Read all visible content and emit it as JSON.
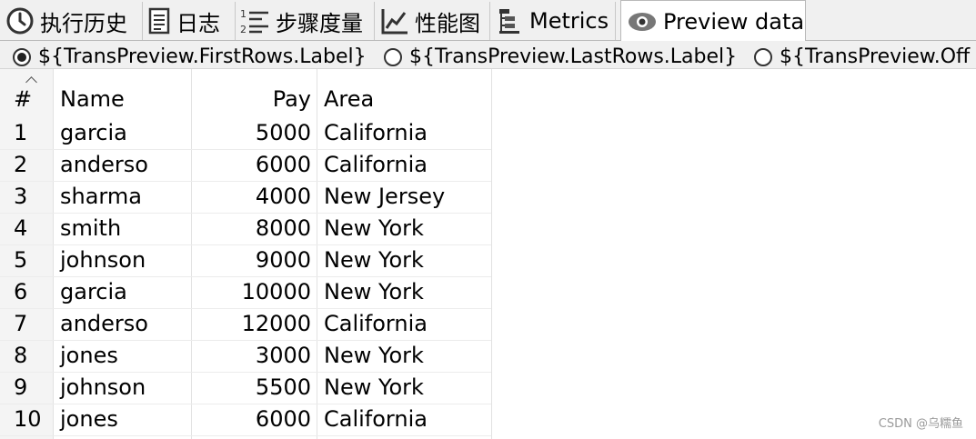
{
  "tabs": [
    {
      "label": "执行历史",
      "icon": "clock-icon"
    },
    {
      "label": "日志",
      "icon": "document-icon"
    },
    {
      "label": "步骤度量",
      "icon": "numbered-list-icon"
    },
    {
      "label": "性能图",
      "icon": "line-chart-icon"
    },
    {
      "label": "Metrics",
      "icon": "hierarchy-icon"
    },
    {
      "label": "Preview data",
      "icon": "eye-icon",
      "active": true
    }
  ],
  "radios": [
    {
      "label": "${TransPreview.FirstRows.Label}",
      "checked": true
    },
    {
      "label": "${TransPreview.LastRows.Label}",
      "checked": false
    },
    {
      "label": "${TransPreview.Off",
      "checked": false
    }
  ],
  "table": {
    "headers": [
      "#",
      "Name",
      "Pay",
      "Area"
    ],
    "rows": [
      [
        "1",
        "garcia",
        "5000",
        "California"
      ],
      [
        "2",
        "anderso",
        "6000",
        "California"
      ],
      [
        "3",
        "sharma",
        "4000",
        "New Jersey"
      ],
      [
        "4",
        "smith",
        "8000",
        "New York"
      ],
      [
        "5",
        "johnson",
        "9000",
        "New York"
      ],
      [
        "6",
        "garcia",
        "10000",
        "New York"
      ],
      [
        "7",
        "anderso",
        "12000",
        "California"
      ],
      [
        "8",
        "jones",
        "3000",
        "New York"
      ],
      [
        "9",
        "johnson",
        "5500",
        "New York"
      ],
      [
        "10",
        "jones",
        "6000",
        "California"
      ]
    ]
  },
  "watermark": "CSDN @乌糯鱼"
}
